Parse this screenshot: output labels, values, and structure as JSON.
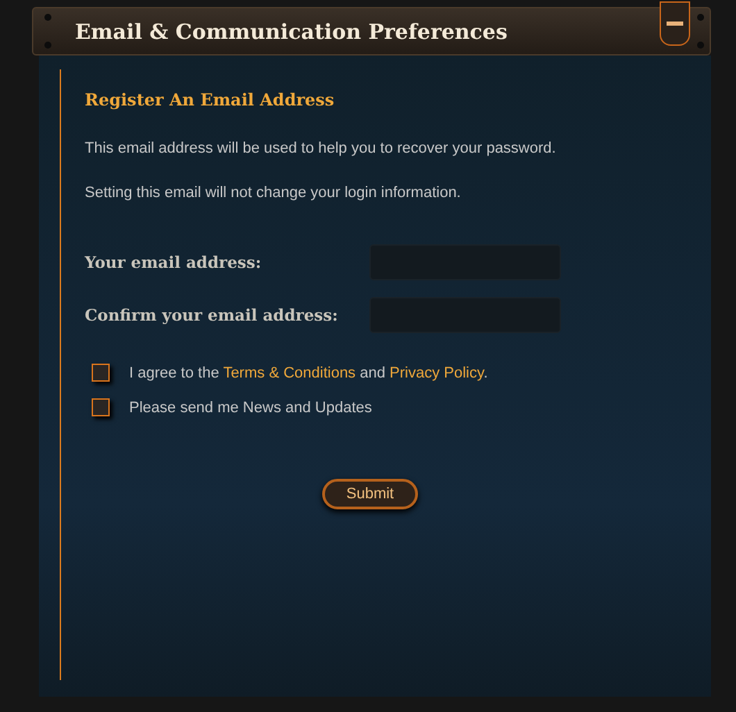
{
  "panel": {
    "title": "Email & Communication Preferences",
    "collapsed": false
  },
  "section": {
    "heading": "Register An Email Address",
    "notes": [
      "This email address will be used to help you to recover your password.",
      "Setting this email will not change your login information."
    ]
  },
  "fields": [
    {
      "label": "Your email address:"
    },
    {
      "label": "Confirm your email address:"
    }
  ],
  "agree": {
    "before": "I agree to the ",
    "terms_link": "Terms & Conditions",
    "middle": " and ",
    "privacy_link": "Privacy Policy",
    "after": ".",
    "checked": false
  },
  "newsletter": {
    "label": "Please send me News and Updates",
    "checked": false
  },
  "submit": "Submit"
}
